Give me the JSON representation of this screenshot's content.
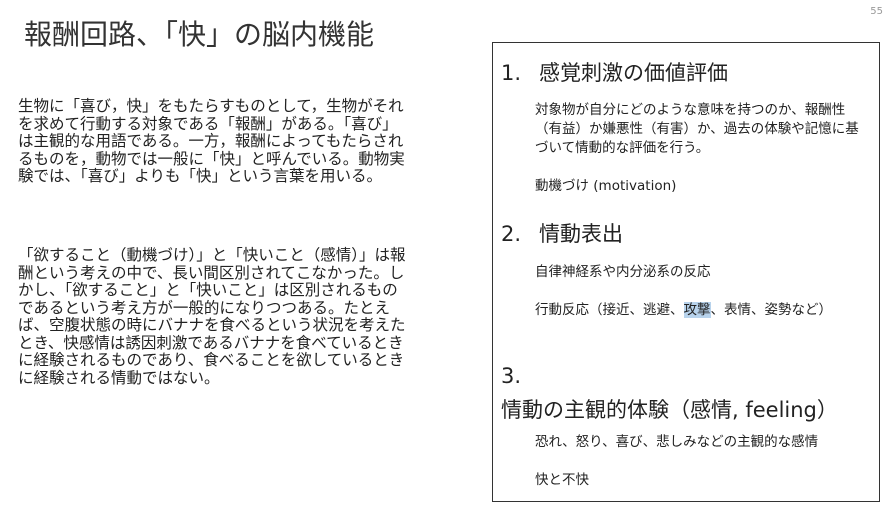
{
  "page_number": "55",
  "title": "報酬回路、「快」の脳内機能",
  "left": {
    "paragraph1": "生物に「喜び，快」をもたらすものとして，生物がそれを求めて行動する対象である「報酬」がある。「喜び」は主観的な用語である。一方，報酬によってもたらされるものを，動物では一般に「快」と呼んでいる。動物実験では、「喜び」よりも「快」という言葉を用いる。",
    "paragraph2": "「欲すること（動機づけ）」と「快いこと（感情）」は報酬という考えの中で、長い間区別されてこなかった。しかし、「欲すること」と「快いこと」は区別されるものであるという考え方が一般的になりつつある。たとえば、空腹状態の時にバナナを食べるという状況を考えたとき、快感情は誘因刺激であるバナナを食べているときに経験されるものであり、食べることを欲しているときに経験される情動ではない。"
  },
  "right": {
    "sections": [
      {
        "number": "1.",
        "heading": "感覚刺激の価値評価",
        "items": [
          "対象物が自分にどのような意味を持つのか、報酬性（有益）か嫌悪性（有害）か、過去の体験や記憶に基づいて情動的な評価を行う。",
          "動機づけ (motivation)"
        ]
      },
      {
        "number": "2.",
        "heading": "情動表出",
        "items": [
          "自律神経系や内分泌系の反応",
          {
            "before": "行動反応（接近、逃避、",
            "highlight": "攻撃",
            "after": "、表情、姿勢など）"
          }
        ]
      },
      {
        "number": "3.",
        "heading": "情動の主観的体験（感情, feeling）",
        "items": [
          "恐れ、怒り、喜び、悲しみなどの主観的な感情",
          "快と不快"
        ]
      }
    ]
  }
}
